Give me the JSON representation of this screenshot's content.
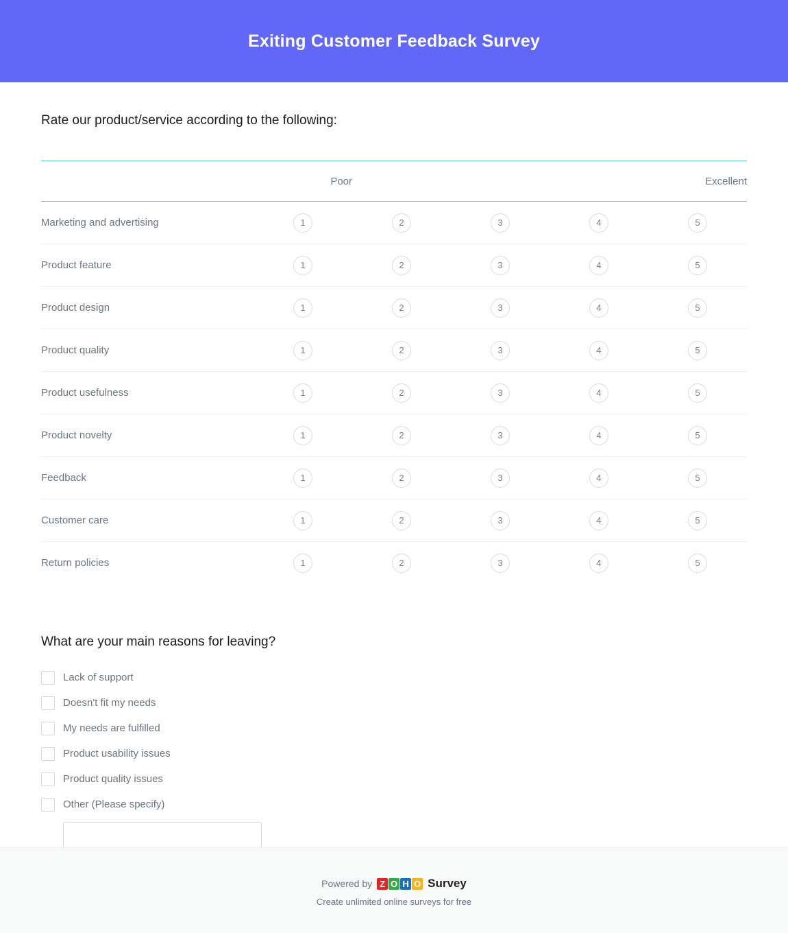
{
  "header": {
    "title": "Exiting Customer Feedback Survey",
    "background_color": "#6167f7",
    "text_color": "#ffffff"
  },
  "accent_colors": {
    "matrix_rule": "#5ecfc4",
    "row_divider": "#eceef0",
    "control_border": "#d5d9dd"
  },
  "question1": {
    "title": "Rate our product/service according to the following:",
    "scale_low_label": "Poor",
    "scale_high_label": "Excellent",
    "blank_header": "",
    "scale_values": [
      "1",
      "2",
      "3",
      "4",
      "5"
    ],
    "rows": [
      {
        "label": "Marketing and advertising"
      },
      {
        "label": "Product feature"
      },
      {
        "label": "Product design"
      },
      {
        "label": "Product quality"
      },
      {
        "label": "Product usefulness"
      },
      {
        "label": "Product novelty"
      },
      {
        "label": "Feedback"
      },
      {
        "label": "Customer care"
      },
      {
        "label": "Return policies"
      }
    ]
  },
  "question2": {
    "title": "What are your main reasons for leaving?",
    "options": [
      {
        "label": "Lack of support",
        "checked": false
      },
      {
        "label": "Doesn't fit my needs",
        "checked": false
      },
      {
        "label": "My needs are fulfilled",
        "checked": false
      },
      {
        "label": "Product usability issues",
        "checked": false
      },
      {
        "label": "Product quality issues",
        "checked": false
      },
      {
        "label": "Other (Please specify)",
        "checked": false
      }
    ],
    "other_input": {
      "value": "",
      "placeholder": ""
    }
  },
  "footer": {
    "powered_by": "Powered by",
    "logo_tiles": [
      "Z",
      "O",
      "H",
      "O"
    ],
    "product_name": "Survey",
    "tagline": "Create unlimited online surveys for free"
  }
}
